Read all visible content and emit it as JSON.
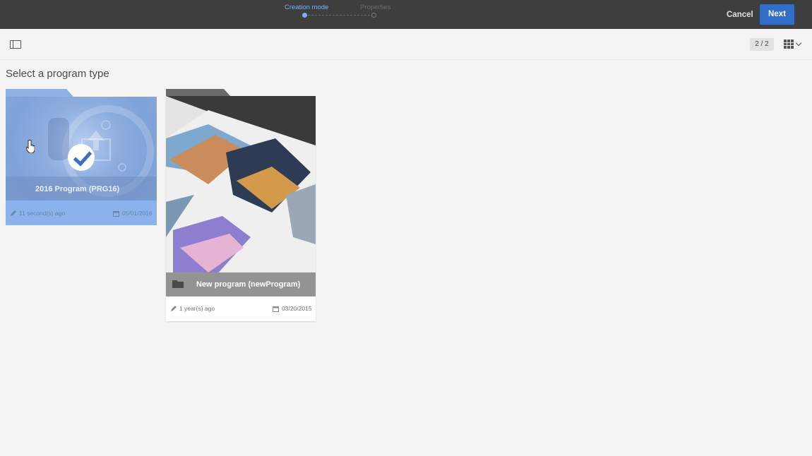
{
  "wizard": {
    "steps": [
      {
        "label": "Creation mode",
        "active": true
      },
      {
        "label": "Properties",
        "active": false
      }
    ],
    "cancel_label": "Cancel",
    "next_label": "Next"
  },
  "toolbar": {
    "panel_toggle_icon": "panel-toggle-icon",
    "page_count": "2 / 2",
    "view_icon": "grid-view-icon"
  },
  "page": {
    "title": "Select a program type"
  },
  "cards": [
    {
      "name": "2016 Program (PRG16)",
      "modified": "11 second(s) ago",
      "date": "05/01/2016",
      "selected": true
    },
    {
      "name": "New program (newProgram)",
      "modified": "1 year(s) ago",
      "date": "03/20/2015",
      "selected": false
    }
  ],
  "colors": {
    "topbar": "#3e3e3e",
    "accent": "#326ec8",
    "selected_card": "#8cb2ee",
    "active_step": "#7fb0f0"
  }
}
